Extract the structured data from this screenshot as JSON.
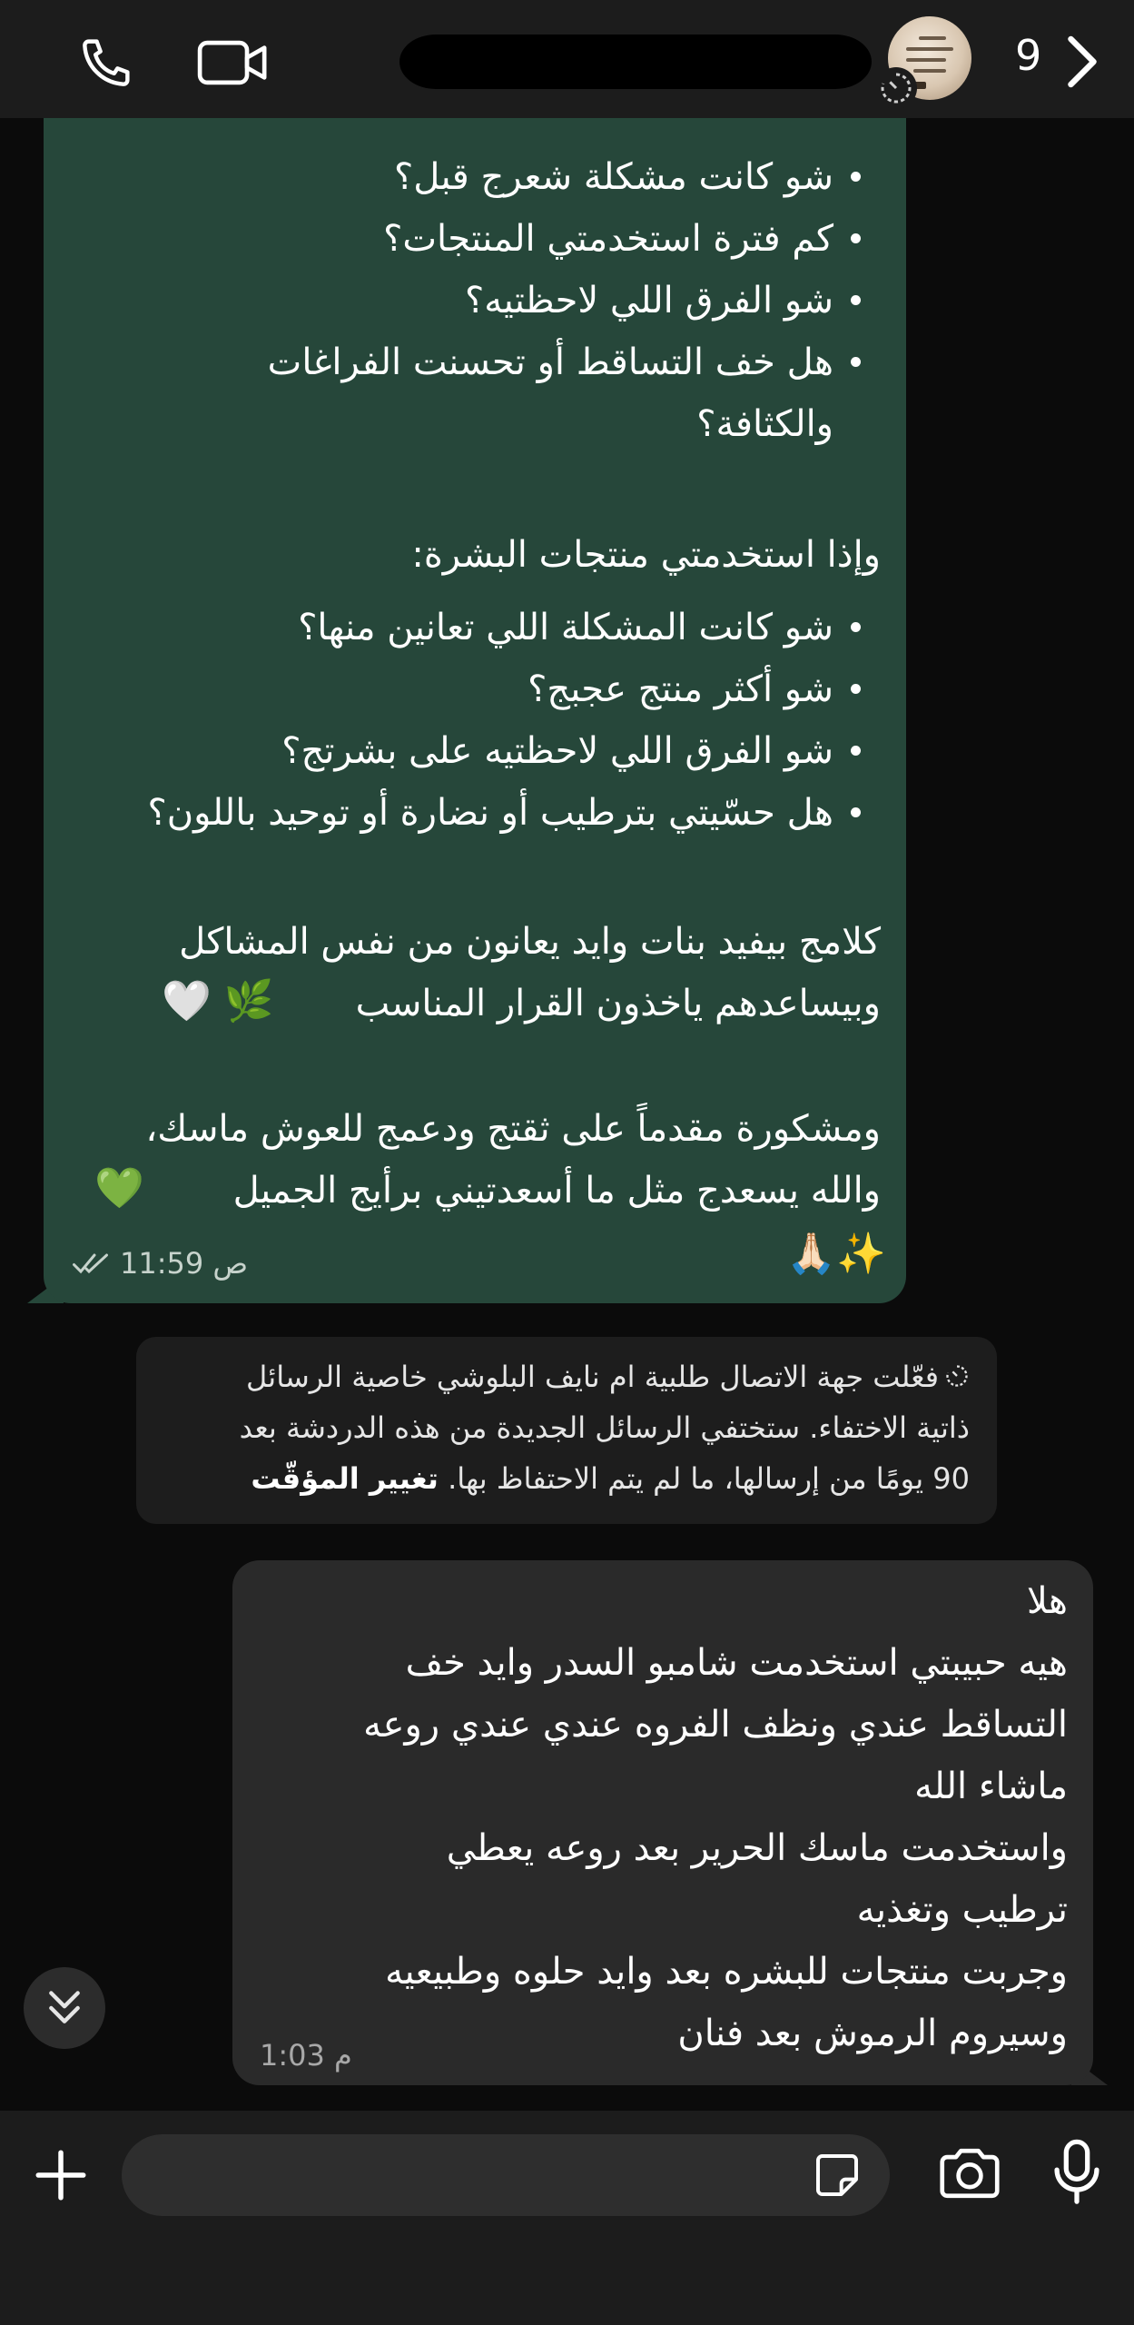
{
  "header": {
    "unread_count": "9",
    "icons": {
      "call": "phone-icon",
      "video": "video-camera-icon",
      "back": "chevron-right-icon",
      "timer": "disappearing-timer-icon"
    }
  },
  "incoming_message": {
    "hair_bullets": [
      "شو كانت مشكلة شعرج قبل؟",
      "كم فترة استخدمتي المنتجات؟",
      "شو الفرق اللي لاحظتيه؟",
      "هل خف التساقط أو تحسنت الفراغات",
      "والكثافة؟"
    ],
    "skin_heading": "وإذا استخدمتي منتجات البشرة:",
    "skin_bullets": [
      "شو كانت المشكلة اللي تعانين منها؟",
      "شو أكثر منتج عجبج؟",
      "شو الفرق اللي لاحظتيه على بشرتج؟",
      "هل حسّيتي بترطيب أو نضارة أو توحيد باللون؟"
    ],
    "paragraph1_line1": "كلامج بيفيد بنات وايد يعانون من نفس المشاكل",
    "paragraph1_line2": "وبيساعدهم ياخذون القرار المناسب",
    "paragraph1_emoji": "🤍 🌿",
    "paragraph2_line1": "ومشكورة مقدماً على ثقتج ودعمج للعوش ماسك،",
    "paragraph2_line2": "والله يسعدج مثل ما أسعدتيني برأيج الجميل",
    "paragraph2_emoji": "💚",
    "closing_emoji": "🙏🏻✨",
    "time": "11:59 ص",
    "status_icon": "double-check-icon"
  },
  "system_notice": {
    "line1": "فعّلت جهة الاتصال طلبية ام نايف البلوشي  خاصية الرسائل",
    "line2": "ذاتية الاختفاء. ستختفي الرسائل الجديدة من هذه الدردشة بعد",
    "line3": "90 يومًا من إرسالها، ما لم يتم الاحتفاظ بها.",
    "link": "تغيير المؤقّت",
    "icon": "disappearing-timer-icon"
  },
  "outgoing_message": {
    "lines": [
      "هلا",
      "هيه حبيبتي  استخدمت شامبو السدر   وايد خف",
      "التساقط عندي  ونظف الفروه  عندي عندي  روعه",
      "ماشاء الله",
      "واستخدمت ماسك الحرير  بعد روعه يعطي",
      "ترطيب وتغذيه",
      "وجربت منتجات للبشره بعد وايد حلوه وطبيعيه",
      "وسيروم الرموش  بعد فنان"
    ],
    "time": "1:03 م"
  },
  "composer": {
    "placeholder": "",
    "icons": {
      "add": "plus-icon",
      "sticker": "sticker-icon",
      "camera": "camera-icon",
      "mic": "microphone-icon"
    }
  },
  "scroll_button_icon": "double-chevron-down-icon"
}
